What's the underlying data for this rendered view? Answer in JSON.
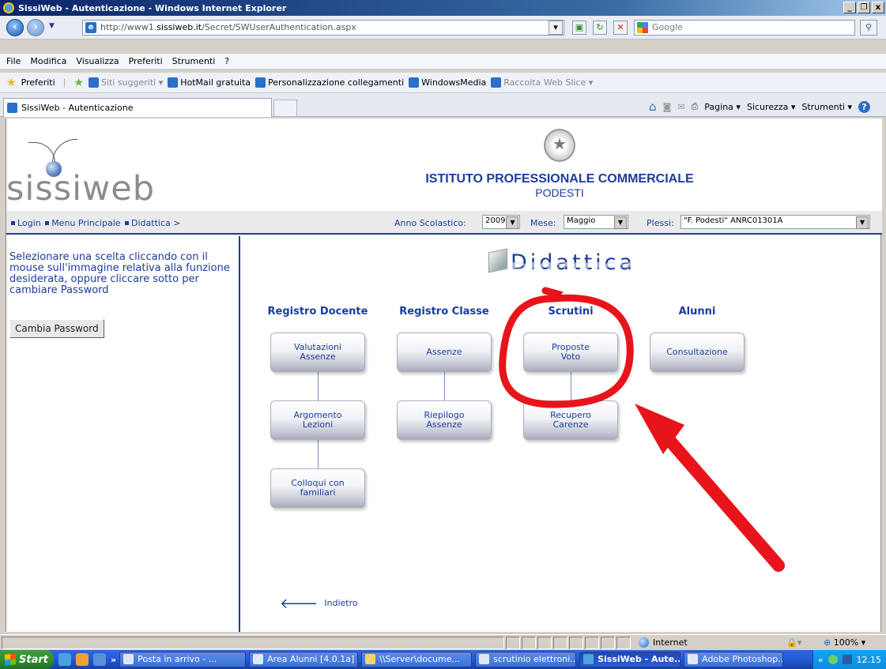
{
  "window": {
    "title": "SissiWeb - Autenticazione - Windows Internet Explorer",
    "controls": [
      "_",
      "❐",
      "x"
    ]
  },
  "address": {
    "prefix": "http://www1.",
    "host": "sissiweb.it",
    "path": "/Secret/SWUserAuthentication.aspx"
  },
  "search": {
    "placeholder": "Google"
  },
  "menu": [
    "File",
    "Modifica",
    "Visualizza",
    "Preferiti",
    "Strumenti",
    "?"
  ],
  "favorites_bar": {
    "label": "Preferiti",
    "items": [
      "Siti suggeriti ▾",
      "HotMail gratuita",
      "Personalizzazione collegamenti",
      "WindowsMedia",
      "Raccolta Web Slice ▾"
    ]
  },
  "tab": {
    "title": "SissiWeb - Autenticazione"
  },
  "command_bar": [
    "Pagina ▾",
    "Sicurezza ▾",
    "Strumenti ▾"
  ],
  "site": {
    "logo": "sissiweb",
    "school_line1": "ISTITUTO PROFESSIONALE COMMERCIALE",
    "school_line2": "PODESTI"
  },
  "breadcrumb": {
    "items": [
      "Login",
      "Menu Principale",
      "Didattica >"
    ]
  },
  "filters": {
    "anno_label": "Anno Scolastico:",
    "anno_value": "2009",
    "mese_label": "Mese:",
    "mese_value": "Maggio",
    "plessi_label": "Plessi:",
    "plessi_value": "\"F. Podesti\" ANRC01301A"
  },
  "left_panel": {
    "instructions": "Selezionare una scelta cliccando con il mouse sull'immagine relativa alla funzione desiderata, oppure cliccare sotto per cambiare Password",
    "password_button": "Cambia Password"
  },
  "main": {
    "section_title": "Didattica",
    "columns": [
      {
        "header": "Registro Docente",
        "buttons": [
          "Valutazioni\nAssenze",
          "Argomento\nLezioni",
          "Colloqui con\nfamiliari"
        ]
      },
      {
        "header": "Registro Classe",
        "buttons": [
          "Assenze",
          "Riepilogo\nAssenze"
        ]
      },
      {
        "header": "Scrutini",
        "buttons": [
          "Proposte\nVoto",
          "Recupero\nCarenze"
        ]
      },
      {
        "header": "Alunni",
        "buttons": [
          "Consultazione"
        ]
      }
    ],
    "back_label": "Indietro"
  },
  "annotation": {
    "color": "#e8141b"
  },
  "status": {
    "zone": "Internet",
    "zoom": "100%"
  },
  "taskbar": {
    "start": "Start",
    "items": [
      "Posta in arrivo - ...",
      "Area Alunni [4.0.1a]",
      "\\\\Server\\docume...",
      "scrutinio elettroni...",
      "SissiWeb - Aute...",
      "Adobe Photoshop..."
    ],
    "active_index": 4,
    "clock": "12.15"
  }
}
